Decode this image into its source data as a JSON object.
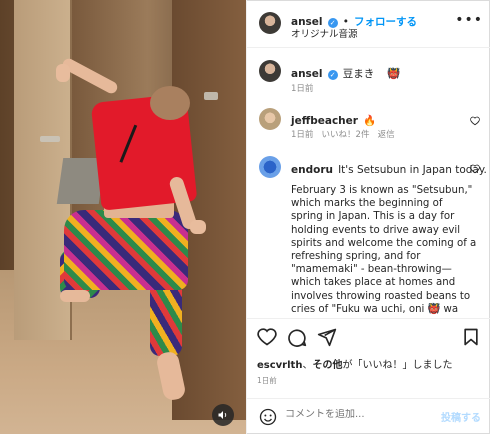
{
  "header": {
    "username": "ansel",
    "verified_icon": "verified-icon",
    "follow_label": "フォローする",
    "separator": "•",
    "audio_label": "オリジナル音源",
    "more_icon": "more-icon"
  },
  "caption": {
    "username": "ansel",
    "text": "豆まき",
    "emoji": "👹",
    "time": "1日前"
  },
  "comments": [
    {
      "username": "jeffbeacher",
      "text": "🔥",
      "time": "1日前",
      "likes": "いいね！2件",
      "reply": "返信"
    },
    {
      "username": "endoru",
      "text": "It's Setsubun in Japan today.",
      "body": "February 3 is known as \"Setsubun,\" which marks the beginning of spring in Japan. This is a day for holding events to drive away evil spirits and welcome the coming of a refreshing spring, and for \"mamemaki\" - bean-throwing—which takes place at homes and involves throwing roasted beans to cries of \"Fuku wa uchi, oni 👹 wa soto\" - meaning"
    }
  ],
  "likes": {
    "user": "escvrlth",
    "connector": "、",
    "others": "その他",
    "suffix": "が「いいね！」しました"
  },
  "date": "1日前",
  "comment_box": {
    "placeholder": "コメントを追加...",
    "post_label": "投稿する"
  },
  "colors": {
    "link": "#0095f6",
    "verified": "#3897f0",
    "muted": "#8e8e8e",
    "post_disabled": "#b3dbff",
    "heart": "#ed4956"
  }
}
